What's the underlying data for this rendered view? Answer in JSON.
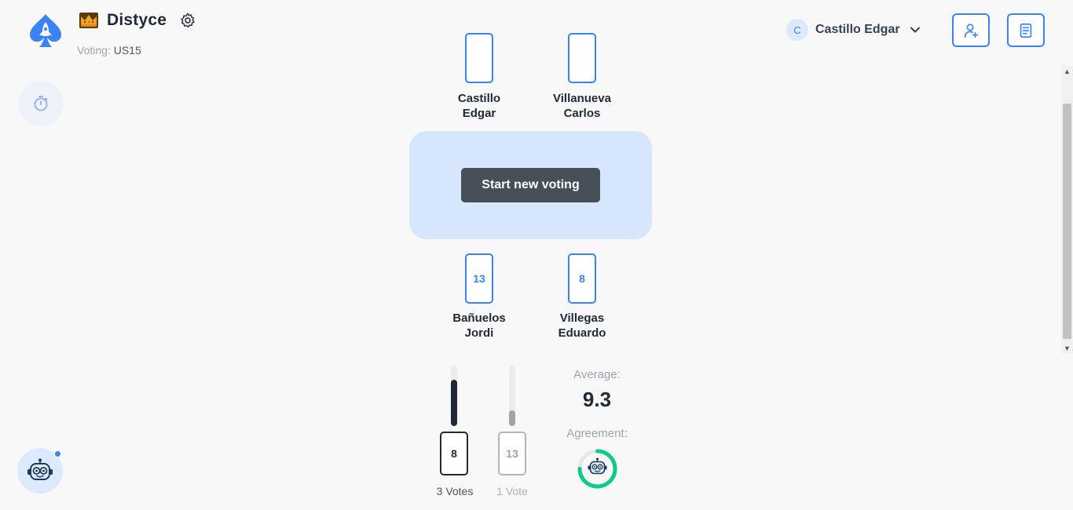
{
  "header": {
    "app_title": "Distyce",
    "voting_label": "Voting:",
    "voting_value": "US15",
    "user_initial": "C",
    "user_name": "Castillo Edgar"
  },
  "players_top": [
    {
      "name_line1": "Castillo",
      "name_line2": "Edgar",
      "card": ""
    },
    {
      "name_line1": "Villanueva",
      "name_line2": "Carlos",
      "card": ""
    }
  ],
  "players_bottom": [
    {
      "name_line1": "Bañuelos",
      "name_line2": "Jordi",
      "card": "13"
    },
    {
      "name_line1": "Villegas",
      "name_line2": "Eduardo",
      "card": "8"
    }
  ],
  "table": {
    "start_button": "Start new voting"
  },
  "results": [
    {
      "card": "8",
      "votes_label": "3 Votes",
      "share": 0.75,
      "color": "#1f2937"
    },
    {
      "card": "13",
      "votes_label": "1 Vote",
      "share": 0.25,
      "color": "#a3a3a3"
    }
  ],
  "stats": {
    "average_label": "Average:",
    "average_value": "9.3",
    "agreement_label": "Agreement:",
    "agreement_fraction": 0.75,
    "agreement_color": "#10c98a"
  },
  "colors": {
    "accent": "#3b82f6",
    "table_bg": "#d6e6fc",
    "button_bg": "#475058"
  }
}
